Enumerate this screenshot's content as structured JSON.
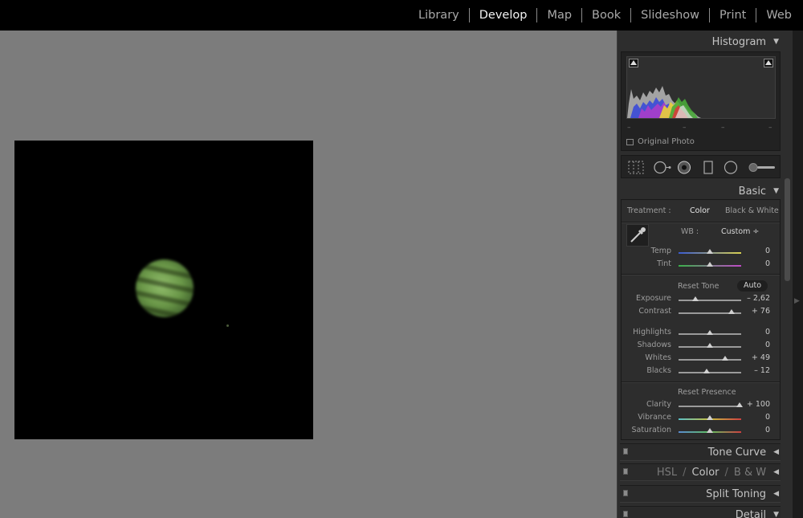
{
  "modules": [
    {
      "label": "Library",
      "active": false
    },
    {
      "label": "Develop",
      "active": true
    },
    {
      "label": "Map",
      "active": false
    },
    {
      "label": "Book",
      "active": false
    },
    {
      "label": "Slideshow",
      "active": false
    },
    {
      "label": "Print",
      "active": false
    },
    {
      "label": "Web",
      "active": false
    }
  ],
  "histogram": {
    "title": "Histogram",
    "readout": [
      "–",
      "–",
      "–",
      "–"
    ],
    "original_photo_label": "Original Photo"
  },
  "basic": {
    "title": "Basic",
    "treatment_label": "Treatment :",
    "treatment_color": "Color",
    "treatment_bw": "Black & White",
    "wb_label": "WB :",
    "wb_value": "Custom ÷",
    "reset_tone": "Reset Tone",
    "auto": "Auto",
    "reset_presence": "Reset Presence",
    "sliders": [
      {
        "name": "Temp",
        "value": "0",
        "pos": 0.5
      },
      {
        "name": "Tint",
        "value": "0",
        "pos": 0.5
      },
      {
        "name": "Exposure",
        "value": "– 2,62",
        "pos": 0.27
      },
      {
        "name": "Contrast",
        "value": "+ 76",
        "pos": 0.84
      },
      {
        "name": "Highlights",
        "value": "0",
        "pos": 0.5
      },
      {
        "name": "Shadows",
        "value": "0",
        "pos": 0.5
      },
      {
        "name": "Whites",
        "value": "+ 49",
        "pos": 0.74
      },
      {
        "name": "Blacks",
        "value": "– 12",
        "pos": 0.45
      },
      {
        "name": "Clarity",
        "value": "+ 100",
        "pos": 0.97
      },
      {
        "name": "Vibrance",
        "value": "0",
        "pos": 0.5
      },
      {
        "name": "Saturation",
        "value": "0",
        "pos": 0.5
      }
    ]
  },
  "panels": {
    "tone_curve": "Tone Curve",
    "hsl": "HSL",
    "slash": "/",
    "color": "Color",
    "bw": "B & W",
    "split_toning": "Split Toning",
    "detail": "Detail"
  },
  "icons": {
    "expand": "▼",
    "collapse": "◀",
    "edge": "▶"
  },
  "colors": {
    "canvas": "#7c7c7c",
    "panel": "#2d2d2d",
    "planet": "#6a9748",
    "active_module": "#f2f2f2"
  }
}
